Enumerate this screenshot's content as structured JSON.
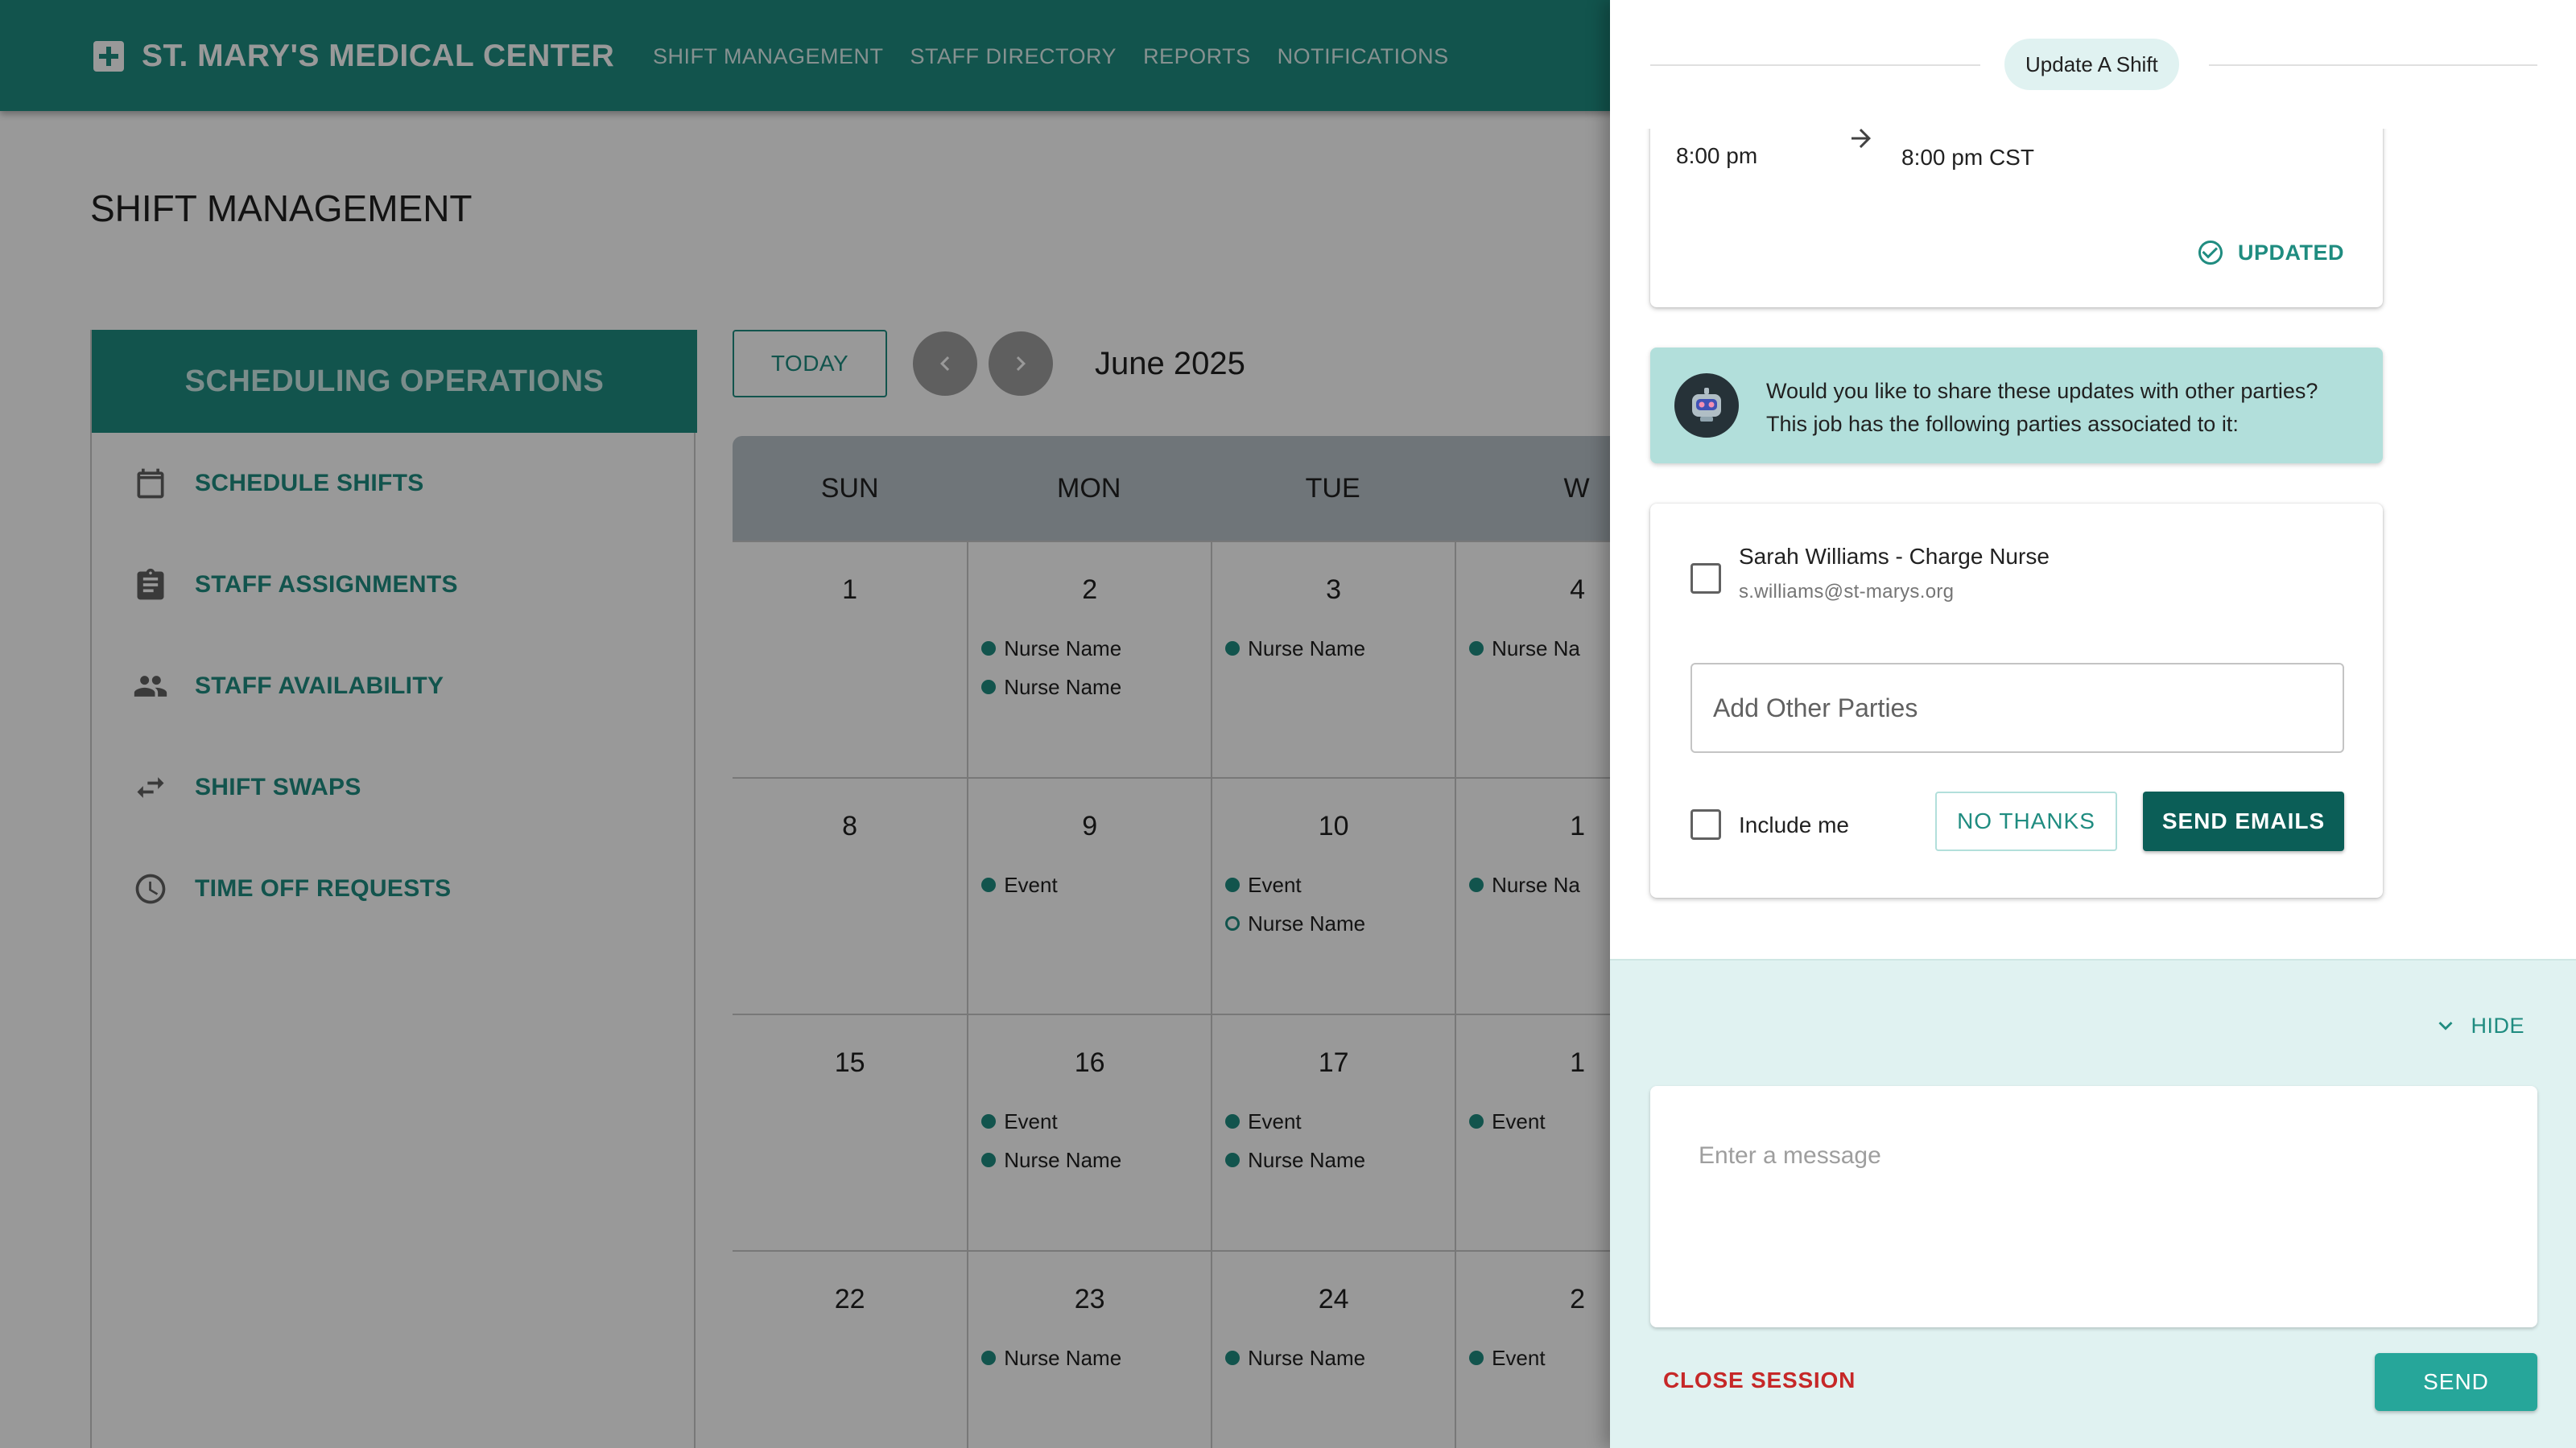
{
  "app": {
    "brand": "ST. MARY'S MEDICAL CENTER",
    "nav": [
      "SHIFT MANAGEMENT",
      "STAFF DIRECTORY",
      "REPORTS",
      "NOTIFICATIONS"
    ],
    "page_title": "SHIFT MANAGEMENT"
  },
  "sidebar": {
    "header": "SCHEDULING OPERATIONS",
    "items": [
      {
        "label": "SCHEDULE SHIFTS",
        "icon": "calendar-icon"
      },
      {
        "label": "STAFF ASSIGNMENTS",
        "icon": "clipboard-icon"
      },
      {
        "label": "STAFF AVAILABILITY",
        "icon": "people-icon"
      },
      {
        "label": "SHIFT SWAPS",
        "icon": "swap-arrows-icon"
      },
      {
        "label": "TIME OFF REQUESTS",
        "icon": "clock-icon"
      }
    ]
  },
  "calendar": {
    "today_label": "TODAY",
    "month": "June 2025",
    "days_of_week": [
      "SUN",
      "MON",
      "TUE",
      "W"
    ],
    "weeks": [
      [
        {
          "day": "1",
          "events": []
        },
        {
          "day": "2",
          "events": [
            {
              "text": "Nurse Name",
              "style": "filled"
            },
            {
              "text": "Nurse Name",
              "style": "filled"
            }
          ]
        },
        {
          "day": "3",
          "events": [
            {
              "text": "Nurse Name",
              "style": "filled"
            }
          ]
        },
        {
          "day": "4",
          "events": [
            {
              "text": "Nurse Na",
              "style": "filled"
            }
          ]
        }
      ],
      [
        {
          "day": "8",
          "events": []
        },
        {
          "day": "9",
          "events": [
            {
              "text": "Event",
              "style": "filled"
            }
          ]
        },
        {
          "day": "10",
          "events": [
            {
              "text": "Event",
              "style": "filled"
            },
            {
              "text": "Nurse Name",
              "style": "hollow"
            }
          ]
        },
        {
          "day": "1",
          "events": [
            {
              "text": "Nurse Na",
              "style": "filled"
            }
          ]
        }
      ],
      [
        {
          "day": "15",
          "events": []
        },
        {
          "day": "16",
          "events": [
            {
              "text": "Event",
              "style": "filled"
            },
            {
              "text": "Nurse Name",
              "style": "filled"
            }
          ]
        },
        {
          "day": "17",
          "events": [
            {
              "text": "Event",
              "style": "filled"
            },
            {
              "text": "Nurse Name",
              "style": "filled"
            }
          ]
        },
        {
          "day": "1",
          "events": [
            {
              "text": "Event",
              "style": "filled"
            }
          ]
        }
      ],
      [
        {
          "day": "22",
          "events": []
        },
        {
          "day": "23",
          "events": [
            {
              "text": "Nurse Name",
              "style": "filled"
            }
          ]
        },
        {
          "day": "24",
          "events": [
            {
              "text": "Nurse Name",
              "style": "filled"
            }
          ]
        },
        {
          "day": "2",
          "events": [
            {
              "text": "Event",
              "style": "filled"
            }
          ]
        }
      ]
    ]
  },
  "panel": {
    "chip": "Update A Shift",
    "time_from": "8:00 pm",
    "time_to": "8:00 pm CST",
    "updated_label": "UPDATED",
    "bot_message": "Would you like to share these updates with other parties? This job has the following parties associated to it:",
    "party": {
      "name": "Sarah Williams - Charge Nurse",
      "email": "s.williams@st-marys.org"
    },
    "other_parties_placeholder": "Add Other Parties",
    "include_me_label": "Include me",
    "no_thanks_label": "NO THANKS",
    "send_emails_label": "SEND EMAILS",
    "hide_label": "HIDE",
    "message_placeholder": "Enter a message",
    "close_session_label": "CLOSE SESSION",
    "send_label": "SEND"
  },
  "colors": {
    "primary": "#1f8c80",
    "primary_dark": "#0b5e57",
    "accent_light": "#b2dfdb",
    "chat_bg": "#e0f2f1",
    "danger": "#c62828"
  }
}
